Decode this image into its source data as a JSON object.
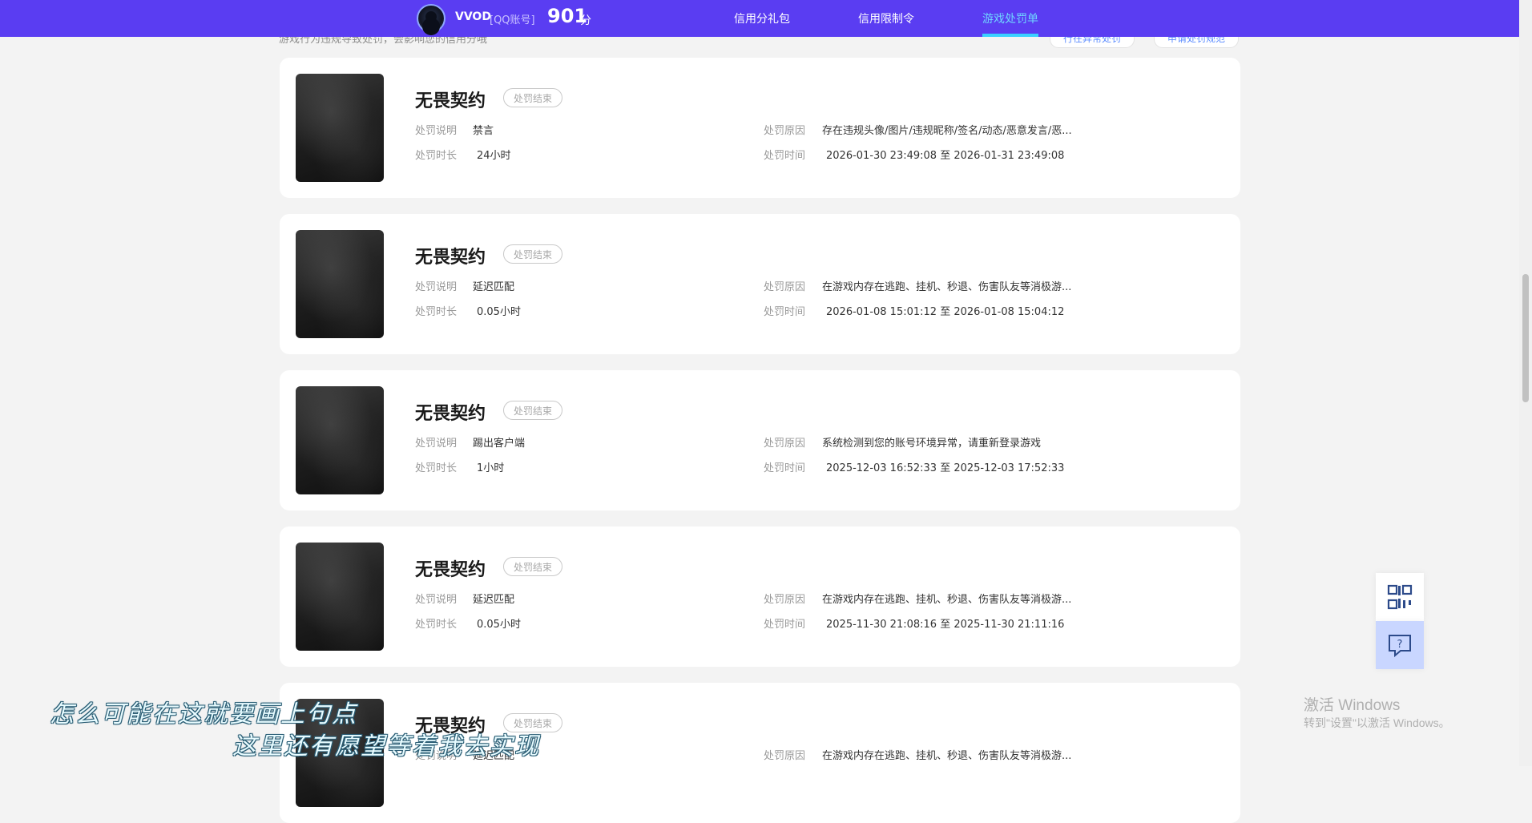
{
  "header": {
    "username": "VVOD",
    "account_type": "[QQ账号]",
    "score": "901",
    "score_unit": "分",
    "nav": [
      {
        "label": "信用分礼包"
      },
      {
        "label": "信用限制令"
      },
      {
        "label": "游戏处罚单"
      }
    ],
    "active_tab": "游戏处罚单",
    "accent_color": "#5a3df2"
  },
  "subheader": {
    "description": "游戏行为违规导致处罚，会影响您的信用分哦",
    "btn1": "行在异常处罚",
    "btn2": "申请处罚规范"
  },
  "labels": {
    "desc": "处罚说明",
    "duration": "处罚时长",
    "reason": "处罚原因",
    "time": "处罚时间"
  },
  "cards": [
    {
      "game": "无畏契约",
      "status": "处罚结束",
      "desc": "禁言",
      "duration": "24小时",
      "reason": "存在违规头像/图片/违规昵称/签名/动态/恶意发言/恶...",
      "time": "2026-01-30 23:49:08 至 2026-01-31 23:49:08"
    },
    {
      "game": "无畏契约",
      "status": "处罚结束",
      "desc": "延迟匹配",
      "duration": "0.05小时",
      "reason": "在游戏内存在逃跑、挂机、秒退、伤害队友等消极游...",
      "time": "2026-01-08 15:01:12 至 2026-01-08 15:04:12"
    },
    {
      "game": "无畏契约",
      "status": "处罚结束",
      "desc": "踢出客户端",
      "duration": "1小时",
      "reason": "系统检测到您的账号环境异常，请重新登录游戏",
      "time": "2025-12-03 16:52:33 至 2025-12-03 17:52:33"
    },
    {
      "game": "无畏契约",
      "status": "处罚结束",
      "desc": "延迟匹配",
      "duration": "0.05小时",
      "reason": "在游戏内存在逃跑、挂机、秒退、伤害队友等消极游...",
      "time": "2025-11-30 21:08:16 至 2025-11-30 21:11:16"
    },
    {
      "game": "无畏契约",
      "status": "处罚结束",
      "desc": "延迟匹配",
      "duration": "",
      "reason": "在游戏内存在逃跑、挂机、秒退、伤害队友等消极游...",
      "time": ""
    }
  ],
  "floating": {
    "qr_icon": "qr-code-icon",
    "help_icon": "help-chat-icon"
  },
  "windows_watermark": {
    "title": "激活 Windows",
    "subtitle": "转到\"设置\"以激活 Windows。"
  },
  "caption": {
    "line1": "怎么可能在这就要画上句点",
    "line2": "这里还有愿望等着我去实现"
  }
}
